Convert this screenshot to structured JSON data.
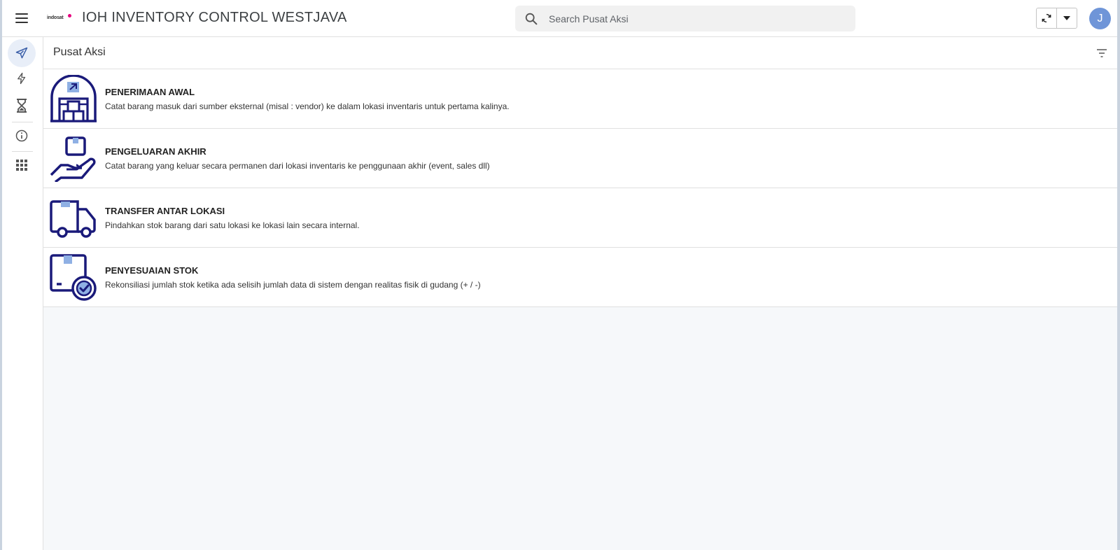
{
  "header": {
    "logo_text": "indosat",
    "app_title": "IOH INVENTORY CONTROL WESTJAVA",
    "search_placeholder": "Search Pusat Aksi",
    "avatar_initial": "J"
  },
  "sidebar": {
    "items": [
      {
        "name": "send-icon",
        "active": true
      },
      {
        "name": "lightning-icon",
        "active": false
      },
      {
        "name": "hourglass-icon",
        "active": false
      },
      {
        "name": "info-icon",
        "active": false
      },
      {
        "name": "apps-grid-icon",
        "active": false
      }
    ]
  },
  "main": {
    "section_title": "Pusat Aksi",
    "actions": [
      {
        "icon": "warehouse-icon",
        "title": "PENERIMAAN AWAL",
        "description": "Catat barang masuk dari sumber eksternal (misal : vendor) ke dalam lokasi inventaris untuk pertama kalinya."
      },
      {
        "icon": "hand-box-icon",
        "title": "PENGELUARAN AKHIR",
        "description": "Catat barang yang keluar secara permanen dari lokasi inventaris ke penggunaan akhir (event, sales dll)"
      },
      {
        "icon": "truck-icon",
        "title": "TRANSFER ANTAR LOKASI",
        "description": "Pindahkan stok barang dari satu lokasi ke lokasi lain secara internal."
      },
      {
        "icon": "box-check-icon",
        "title": "PENYESUAIAN STOK",
        "description": "Rekonsiliasi jumlah stok ketika ada selisih jumlah data di sistem dengan realitas fisik di gudang (+ / -)"
      }
    ]
  },
  "colors": {
    "icon_navy": "#1a1a7a",
    "icon_light_blue": "#8fb0e4",
    "avatar_bg": "#6f95d8",
    "brand_dot": "#e6007e"
  }
}
